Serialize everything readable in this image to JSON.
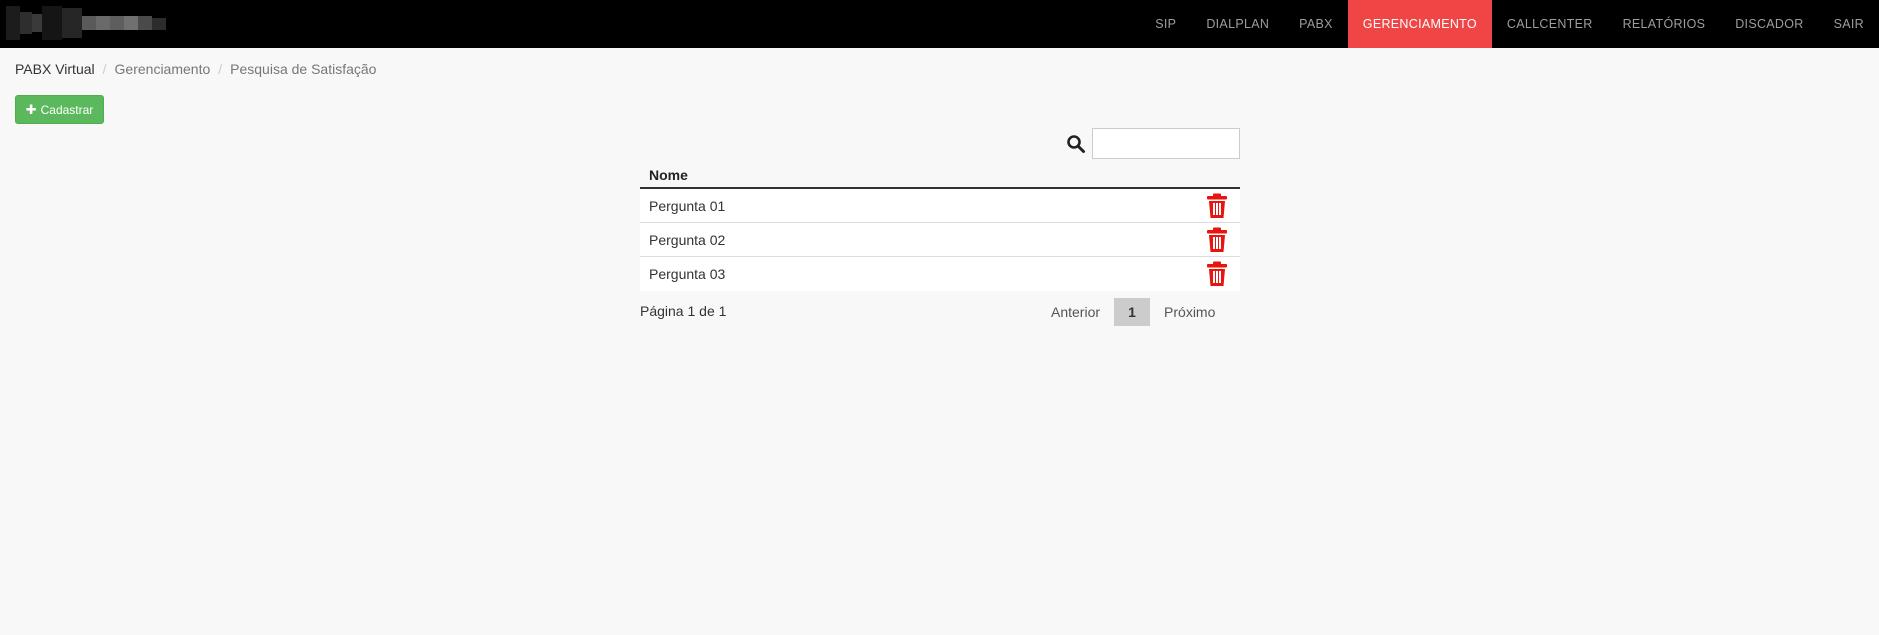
{
  "navbar": {
    "items": [
      {
        "label": "SIP"
      },
      {
        "label": "DIALPLAN"
      },
      {
        "label": "PABX"
      },
      {
        "label": "GERENCIAMENTO",
        "active": true
      },
      {
        "label": "CALLCENTER"
      },
      {
        "label": "RELATÓRIOS"
      },
      {
        "label": "DISCADOR"
      },
      {
        "label": "SAIR"
      }
    ],
    "active_color": "#f04545"
  },
  "breadcrumb": {
    "items": [
      "PABX Virtual",
      "Gerenciamento",
      "Pesquisa de Satisfação"
    ],
    "separator": "/"
  },
  "add_button": {
    "label": "Cadastrar",
    "icon": "plus-icon",
    "color": "#5cb85c"
  },
  "search": {
    "icon": "search-icon",
    "placeholder": "",
    "value": ""
  },
  "table": {
    "columns": [
      "Nome"
    ],
    "rows": [
      {
        "name": "Pergunta 01",
        "action_icon": "trash-icon"
      },
      {
        "name": "Pergunta 02",
        "action_icon": "trash-icon"
      },
      {
        "name": "Pergunta 03",
        "action_icon": "trash-icon"
      }
    ],
    "delete_color": "#e8140f"
  },
  "pagination": {
    "info": "Página 1 de 1",
    "prev": "Anterior",
    "current": "1",
    "next": "Próximo"
  }
}
